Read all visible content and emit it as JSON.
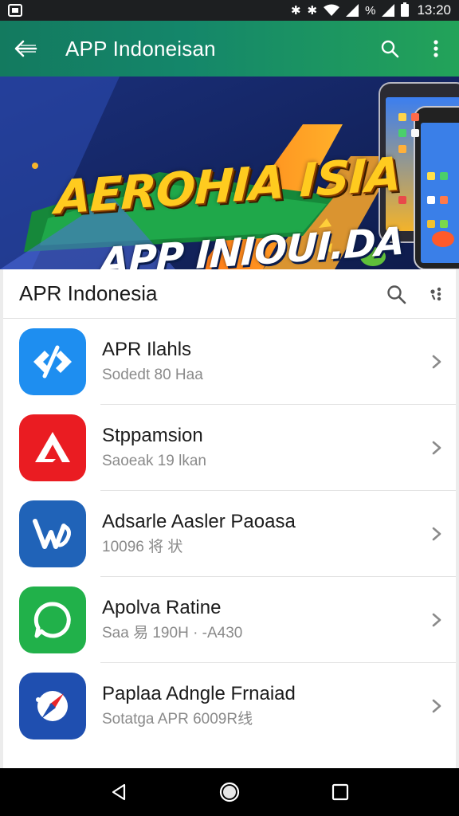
{
  "status_bar": {
    "time": "13:20",
    "icons": [
      "save-icon",
      "bluetooth-icon",
      "bluetooth-icon",
      "wifi-icon",
      "signal-icon",
      "mute-icon",
      "signal-icon",
      "battery-icon"
    ]
  },
  "toolbar": {
    "title": "APP Indoneisan",
    "back_icon": "back-arrow-icon",
    "search_icon": "search-icon",
    "menu_icon": "more-vert-icon",
    "colors": {
      "start": "#137a5f",
      "end": "#23a359"
    }
  },
  "banner": {
    "headline": "AEROHIA ISIA",
    "subheadline": "APP INIOUI.DA"
  },
  "section": {
    "title": "APR Indonesia",
    "search_icon": "search-icon",
    "more_icon": "more-icon"
  },
  "apps": [
    {
      "name": "APR Ilahls",
      "subtitle": "Sodedt 80 Haa",
      "icon": "code-arrows-icon",
      "color": "#1e8ef0"
    },
    {
      "name": "Stppamsion",
      "subtitle": "Saoeak 19 lkan",
      "icon": "a-letter-icon",
      "color": "#ea1c22"
    },
    {
      "name": "Adsarle Aasler Paoasa",
      "subtitle": "10096 将 状",
      "icon": "aw-logo-icon",
      "color": "#2063b8"
    },
    {
      "name": "Apolva Ratine",
      "subtitle": "Saa 易 190H · -A430",
      "icon": "chat-bubble-icon",
      "color": "#21b14a"
    },
    {
      "name": "Paplaa Adngle Frnaiad",
      "subtitle": "Sotatga APR 6009R线",
      "icon": "compass-icon",
      "color": "#1f4fb0"
    }
  ],
  "nav_bar": {
    "back_icon": "nav-back-icon",
    "home_icon": "nav-home-icon",
    "recents_icon": "nav-recents-icon"
  }
}
